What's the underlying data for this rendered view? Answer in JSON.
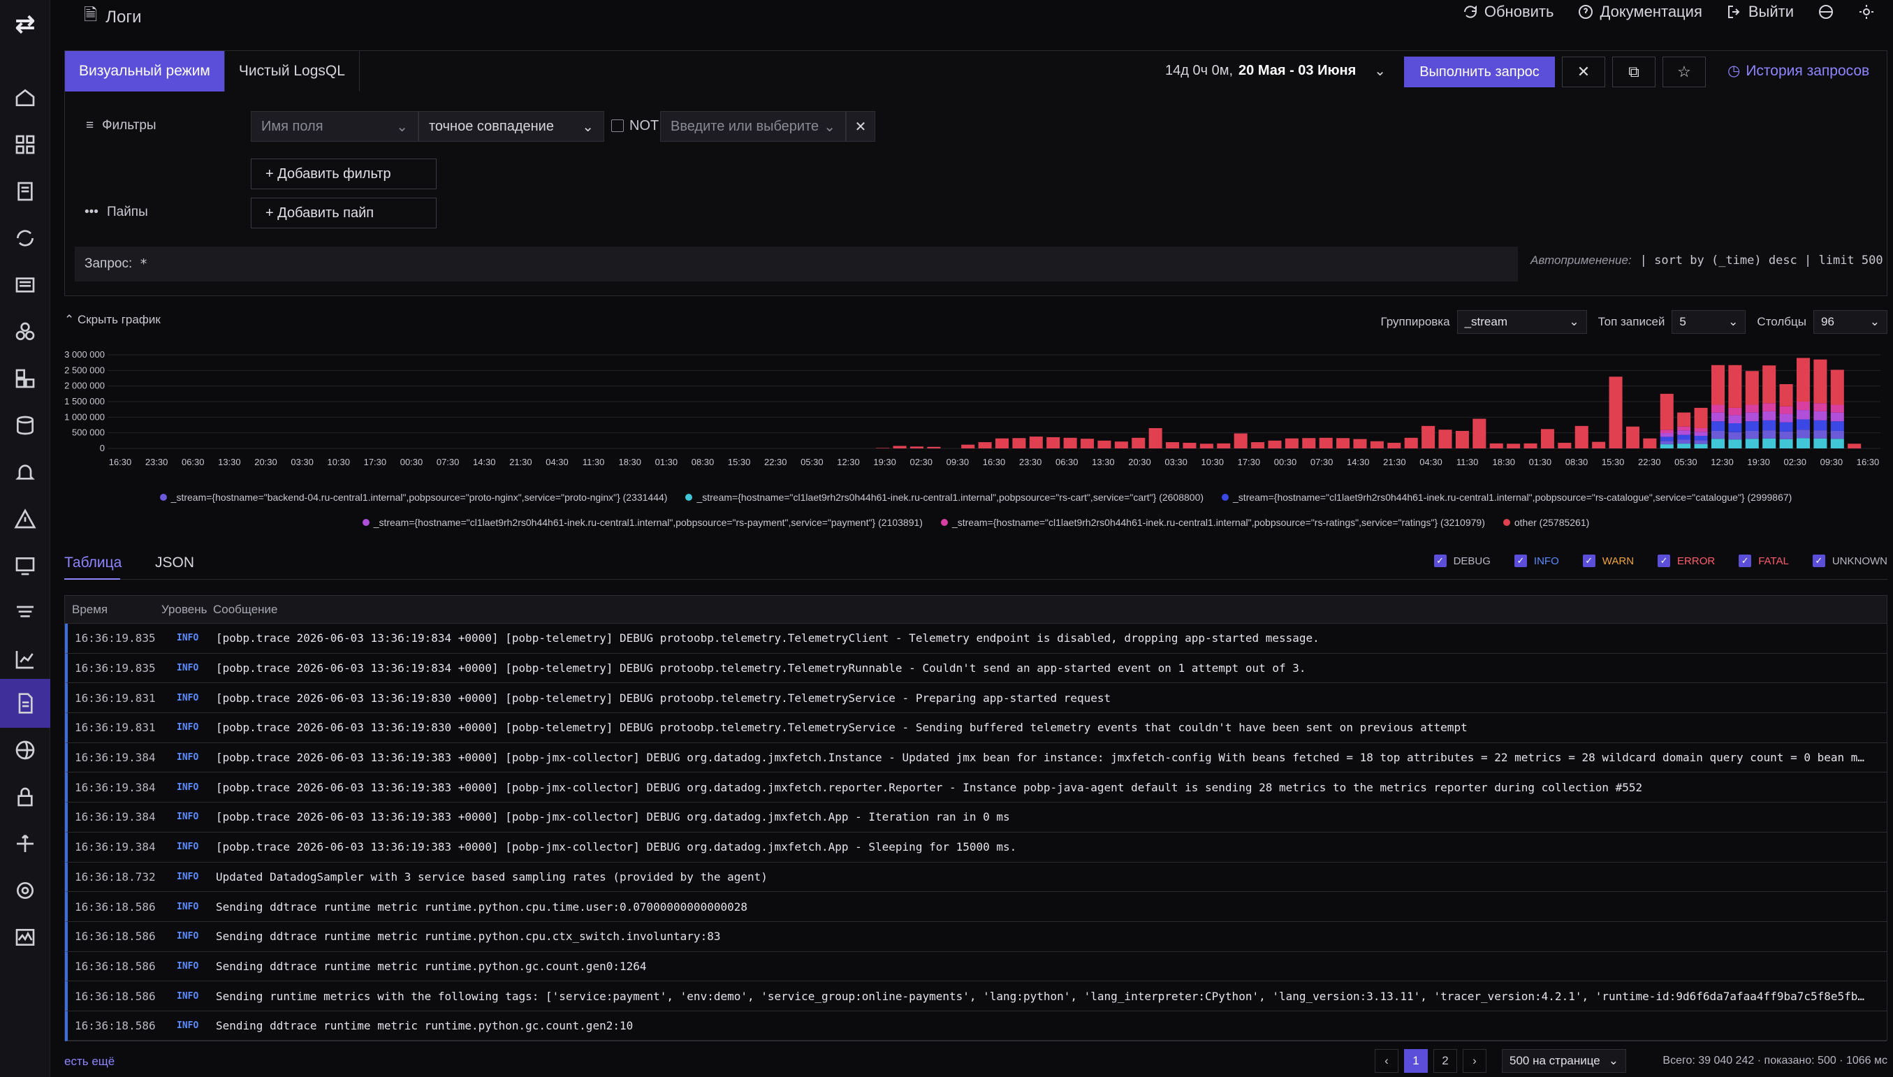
{
  "app": {
    "title": "Логи"
  },
  "top_actions": {
    "refresh": "Обновить",
    "docs": "Документация",
    "logout": "Выйти"
  },
  "mode_tabs": [
    "Визуальный режим",
    "Чистый LogsQL"
  ],
  "daterange": {
    "prefix": "14д 0ч 0м,",
    "range": "20 Мая - 03 Июня"
  },
  "run_button": "Выполнить запрос",
  "history": "История запросов",
  "filters": {
    "label": "Фильтры",
    "field_placeholder": "Имя поля",
    "match_type": "точное совпадение",
    "not_label": "NOT",
    "value_placeholder": "Введите или выберите",
    "add_filter": "+ Добавить фильтр"
  },
  "pipes": {
    "label": "Пайпы",
    "add_pipe": "+ Добавить пайп"
  },
  "query": {
    "label": "Запрос:",
    "value": "*"
  },
  "autoapply": {
    "label": "Автоприменение:",
    "value": "| sort by (_time) desc  | limit 500"
  },
  "chart_controls": {
    "hide": "Скрыть график",
    "grouping_label": "Группировка",
    "grouping_value": "_stream",
    "top_label": "Топ записей",
    "top_value": "5",
    "cols_label": "Столбцы",
    "cols_value": "96"
  },
  "chart_data": {
    "type": "bar",
    "stacked": true,
    "y_ticks": [
      "3 000 000",
      "2 500 000",
      "2 000 000",
      "1 500 000",
      "1 000 000",
      "500 000",
      "0"
    ],
    "ylim": [
      0,
      3000000
    ],
    "x_ticks": [
      "16:30",
      "23:30",
      "06:30",
      "13:30",
      "20:30",
      "03:30",
      "10:30",
      "17:30",
      "00:30",
      "07:30",
      "14:30",
      "21:30",
      "04:30",
      "11:30",
      "18:30",
      "01:30",
      "08:30",
      "15:30",
      "22:30",
      "05:30",
      "12:30",
      "19:30",
      "02:30",
      "09:30",
      "16:30",
      "23:30",
      "06:30",
      "13:30",
      "20:30",
      "03:30",
      "10:30",
      "17:30",
      "00:30",
      "07:30",
      "14:30",
      "21:30",
      "04:30",
      "11:30",
      "18:30",
      "01:30",
      "08:30",
      "15:30",
      "22:30",
      "05:30",
      "12:30",
      "19:30",
      "02:30",
      "09:30",
      "16:30"
    ],
    "bars_total": [
      0,
      0,
      0,
      0,
      0,
      0,
      0,
      0,
      0,
      0,
      0,
      0,
      0,
      0,
      0,
      0,
      0,
      0,
      0,
      0,
      0,
      0,
      0,
      0,
      0,
      0,
      0,
      0,
      0,
      0,
      0,
      0,
      0,
      0,
      0,
      0,
      0,
      0,
      0,
      0,
      0,
      0,
      0,
      0,
      0,
      0,
      0,
      0,
      0,
      0,
      0,
      0,
      0,
      0,
      0,
      0,
      0,
      0,
      0,
      0,
      0,
      0,
      0,
      0,
      0,
      0,
      0,
      0,
      0,
      0,
      0,
      0,
      0,
      0,
      0,
      0,
      0,
      0,
      0,
      0,
      0,
      0,
      0,
      0,
      0,
      0,
      0,
      0,
      0,
      0,
      0,
      0,
      0,
      0,
      0,
      0,
      0,
      0,
      0,
      0,
      0,
      0,
      0,
      0,
      0,
      0,
      0,
      0,
      0,
      0,
      0,
      0,
      0,
      0,
      0,
      0,
      0,
      0,
      0,
      0,
      0,
      0,
      0,
      0,
      0,
      0,
      0,
      0,
      0,
      0,
      0,
      0,
      0,
      0,
      0,
      0,
      0,
      0,
      0,
      0,
      0,
      0,
      0,
      0,
      0,
      0,
      0,
      0,
      0,
      0,
      0,
      0,
      0,
      0,
      0,
      0,
      0,
      0,
      0,
      0,
      0,
      0,
      0,
      0,
      0,
      0,
      0,
      0,
      0,
      0,
      0,
      0,
      0,
      0,
      0,
      0,
      0,
      0,
      0,
      0,
      0,
      0,
      0,
      0,
      0,
      0,
      0,
      0,
      0,
      0,
      0,
      0,
      0,
      0
    ],
    "series": [
      {
        "name": "_stream={hostname=\"backend-04.ru-central1.internal\",pobpsource=\"proto-nginx\",service=\"proto-nginx\"} (2331444)",
        "color": "#6b5bd9"
      },
      {
        "name": "_stream={hostname=\"cl1laet9rh2rs0h44h61-inek.ru-central1.internal\",pobpsource=\"rs-cart\",service=\"cart\"} (2608800)",
        "color": "#41c6d8"
      },
      {
        "name": "_stream={hostname=\"cl1laet9rh2rs0h44h61-inek.ru-central1.internal\",pobpsource=\"rs-catalogue\",service=\"catalogue\"} (2999867)",
        "color": "#3b48e6"
      },
      {
        "name": "_stream={hostname=\"cl1laet9rh2rs0h44h61-inek.ru-central1.internal\",pobpsource=\"rs-payment\",service=\"payment\"} (2103891)",
        "color": "#b04fd9"
      },
      {
        "name": "_stream={hostname=\"cl1laet9rh2rs0h44h61-inek.ru-central1.internal\",pobpsource=\"rs-ratings\",service=\"ratings\"} (3210979)",
        "color": "#d93fa0"
      },
      {
        "name": "other (25785261)",
        "color": "#e0404f"
      }
    ],
    "bars": [
      {
        "x": 45,
        "other": 15000
      },
      {
        "x": 46,
        "other": 80000
      },
      {
        "x": 47,
        "other": 60000
      },
      {
        "x": 48,
        "other": 50000
      },
      {
        "x": 50,
        "other": 120000
      },
      {
        "x": 51,
        "other": 200000
      },
      {
        "x": 52,
        "other": 320000
      },
      {
        "x": 53,
        "other": 330000
      },
      {
        "x": 54,
        "other": 380000
      },
      {
        "x": 55,
        "other": 360000
      },
      {
        "x": 56,
        "other": 340000
      },
      {
        "x": 57,
        "other": 310000
      },
      {
        "x": 58,
        "other": 250000
      },
      {
        "x": 59,
        "other": 220000
      },
      {
        "x": 60,
        "other": 340000
      },
      {
        "x": 61,
        "other": 650000
      },
      {
        "x": 62,
        "other": 200000
      },
      {
        "x": 63,
        "other": 180000
      },
      {
        "x": 64,
        "other": 150000
      },
      {
        "x": 65,
        "other": 160000
      },
      {
        "x": 66,
        "other": 480000
      },
      {
        "x": 67,
        "other": 200000
      },
      {
        "x": 68,
        "other": 250000
      },
      {
        "x": 69,
        "other": 320000
      },
      {
        "x": 70,
        "other": 330000
      },
      {
        "x": 71,
        "other": 340000
      },
      {
        "x": 72,
        "other": 330000
      },
      {
        "x": 73,
        "other": 300000
      },
      {
        "x": 74,
        "other": 230000
      },
      {
        "x": 75,
        "other": 180000
      },
      {
        "x": 76,
        "other": 340000
      },
      {
        "x": 77,
        "other": 720000
      },
      {
        "x": 78,
        "other": 600000
      },
      {
        "x": 79,
        "other": 560000
      },
      {
        "x": 80,
        "other": 950000
      },
      {
        "x": 81,
        "other": 160000
      },
      {
        "x": 82,
        "other": 150000
      },
      {
        "x": 83,
        "other": 160000
      },
      {
        "x": 84,
        "other": 620000
      },
      {
        "x": 85,
        "other": 180000
      },
      {
        "x": 86,
        "other": 720000
      },
      {
        "x": 87,
        "other": 210000
      },
      {
        "x": 88,
        "other": 2300000
      },
      {
        "x": 89,
        "other": 700000
      },
      {
        "x": 90,
        "other": 320000
      },
      {
        "x": 91,
        "other": 1750000,
        "rs": 600000
      },
      {
        "x": 92,
        "other": 1150000,
        "rs": 700000
      },
      {
        "x": 93,
        "other": 1300000,
        "rs": 650000
      },
      {
        "x": 94,
        "other": 2670000,
        "rs": 1400000
      },
      {
        "x": 95,
        "other": 2670000,
        "rs": 1300000
      },
      {
        "x": 96,
        "other": 2480000,
        "rs": 1400000
      },
      {
        "x": 97,
        "other": 2660000,
        "rs": 1450000
      },
      {
        "x": 98,
        "other": 2060000,
        "rs": 1350000
      },
      {
        "x": 99,
        "other": 2900000,
        "rs": 1500000
      },
      {
        "x": 100,
        "other": 2850000,
        "rs": 1450000
      },
      {
        "x": 101,
        "other": 2520000,
        "rs": 1400000
      },
      {
        "x": 102,
        "other": 150000
      }
    ]
  },
  "view_tabs": [
    "Таблица",
    "JSON"
  ],
  "levels": [
    {
      "name": "DEBUG",
      "color": "#b8b8c2"
    },
    {
      "name": "INFO",
      "color": "#5b8cff"
    },
    {
      "name": "WARN",
      "color": "#f0a43a"
    },
    {
      "name": "ERROR",
      "color": "#ff5c6c"
    },
    {
      "name": "FATAL",
      "color": "#ff5c6c"
    },
    {
      "name": "UNKNOWN",
      "color": "#b8b8c2"
    }
  ],
  "table": {
    "headers": [
      "Время",
      "Уровень",
      "Сообщение"
    ],
    "rows": [
      {
        "time": "16:36:19.835",
        "level": "INFO",
        "msg": "[pobp.trace 2026-06-03 13:36:19:834 +0000] [pobp-telemetry] DEBUG protoobp.telemetry.TelemetryClient - Telemetry endpoint is disabled, dropping app-started message."
      },
      {
        "time": "16:36:19.835",
        "level": "INFO",
        "msg": "[pobp.trace 2026-06-03 13:36:19:834 +0000] [pobp-telemetry] DEBUG protoobp.telemetry.TelemetryRunnable - Couldn't send an app-started event on 1 attempt out of 3."
      },
      {
        "time": "16:36:19.831",
        "level": "INFO",
        "msg": "[pobp.trace 2026-06-03 13:36:19:830 +0000] [pobp-telemetry] DEBUG protoobp.telemetry.TelemetryService - Preparing app-started request"
      },
      {
        "time": "16:36:19.831",
        "level": "INFO",
        "msg": "[pobp.trace 2026-06-03 13:36:19:830 +0000] [pobp-telemetry] DEBUG protoobp.telemetry.TelemetryService - Sending buffered telemetry events that couldn't have been sent on previous attempt"
      },
      {
        "time": "16:36:19.384",
        "level": "INFO",
        "msg": "[pobp.trace 2026-06-03 13:36:19:383 +0000] [pobp-jmx-collector] DEBUG org.datadog.jmxfetch.Instance - Updated jmx bean for instance: jmxfetch-config With beans fetched = 18 top attributes = 22 metrics = 28 wildcard domain query count = 0 bean m…"
      },
      {
        "time": "16:36:19.384",
        "level": "INFO",
        "msg": "[pobp.trace 2026-06-03 13:36:19:383 +0000] [pobp-jmx-collector] DEBUG org.datadog.jmxfetch.reporter.Reporter - Instance pobp-java-agent default is sending 28 metrics to the metrics reporter during collection #552"
      },
      {
        "time": "16:36:19.384",
        "level": "INFO",
        "msg": "[pobp.trace 2026-06-03 13:36:19:383 +0000] [pobp-jmx-collector] DEBUG org.datadog.jmxfetch.App - Iteration ran in 0 ms"
      },
      {
        "time": "16:36:19.384",
        "level": "INFO",
        "msg": "[pobp.trace 2026-06-03 13:36:19:383 +0000] [pobp-jmx-collector] DEBUG org.datadog.jmxfetch.App - Sleeping for 15000 ms."
      },
      {
        "time": "16:36:18.732",
        "level": "INFO",
        "msg": "Updated DatadogSampler with 3 service based sampling rates (provided by the agent)"
      },
      {
        "time": "16:36:18.586",
        "level": "INFO",
        "msg": "Sending ddtrace runtime metric runtime.python.cpu.time.user:0.07000000000000028"
      },
      {
        "time": "16:36:18.586",
        "level": "INFO",
        "msg": "Sending ddtrace runtime metric runtime.python.cpu.ctx_switch.involuntary:83"
      },
      {
        "time": "16:36:18.586",
        "level": "INFO",
        "msg": "Sending ddtrace runtime metric runtime.python.gc.count.gen0:1264"
      },
      {
        "time": "16:36:18.586",
        "level": "INFO",
        "msg": "Sending runtime metrics with the following tags: ['service:payment', 'env:demo', 'service_group:online-payments', 'lang:python', 'lang_interpreter:CPython', 'lang_version:3.13.11', 'tracer_version:4.2.1', 'runtime-id:9d6f6da7afaa4ff9ba7c5f8e5fb…"
      },
      {
        "time": "16:36:18.586",
        "level": "INFO",
        "msg": "Sending ddtrace runtime metric runtime.python.gc.count.gen2:10"
      }
    ]
  },
  "footer": {
    "more": "есть ещё",
    "pages": [
      "1",
      "2"
    ],
    "per_page": "500 на странице",
    "totals": "Всего: 39 040 242 · показано: 500 · 1066 мс"
  }
}
